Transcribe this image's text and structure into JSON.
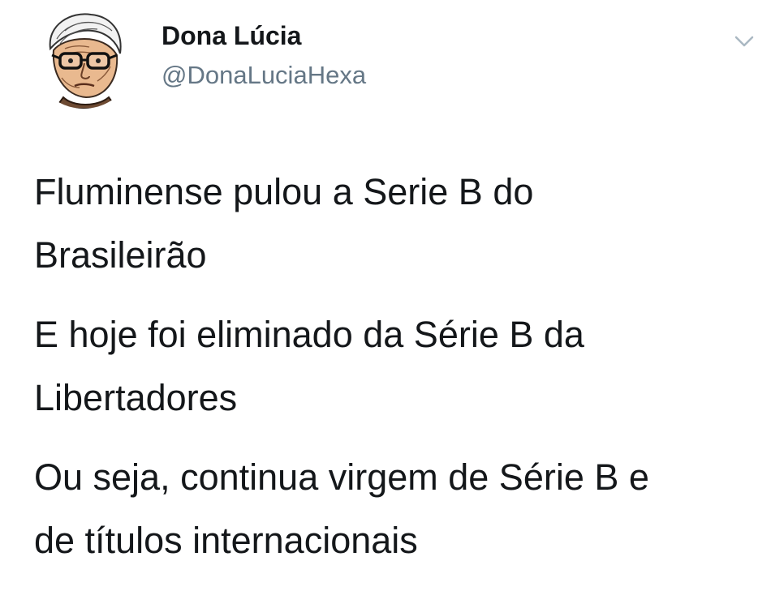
{
  "tweet": {
    "author": {
      "display_name": "Dona Lúcia",
      "handle": "@DonaLuciaHexa",
      "avatar": "sketched-elderly-woman-avatar"
    },
    "menu_icon": "chevron-down-icon",
    "paragraphs": [
      "Fluminense pulou a Serie B do\nBrasileirão",
      "E hoje foi eliminado da Série B da\nLibertadores",
      "Ou seja, continua virgem de Série B e\nde títulos internacionais"
    ]
  },
  "colors": {
    "text_primary": "#14171a",
    "text_secondary": "#657786",
    "caret": "#aab8c2",
    "background": "#ffffff"
  }
}
